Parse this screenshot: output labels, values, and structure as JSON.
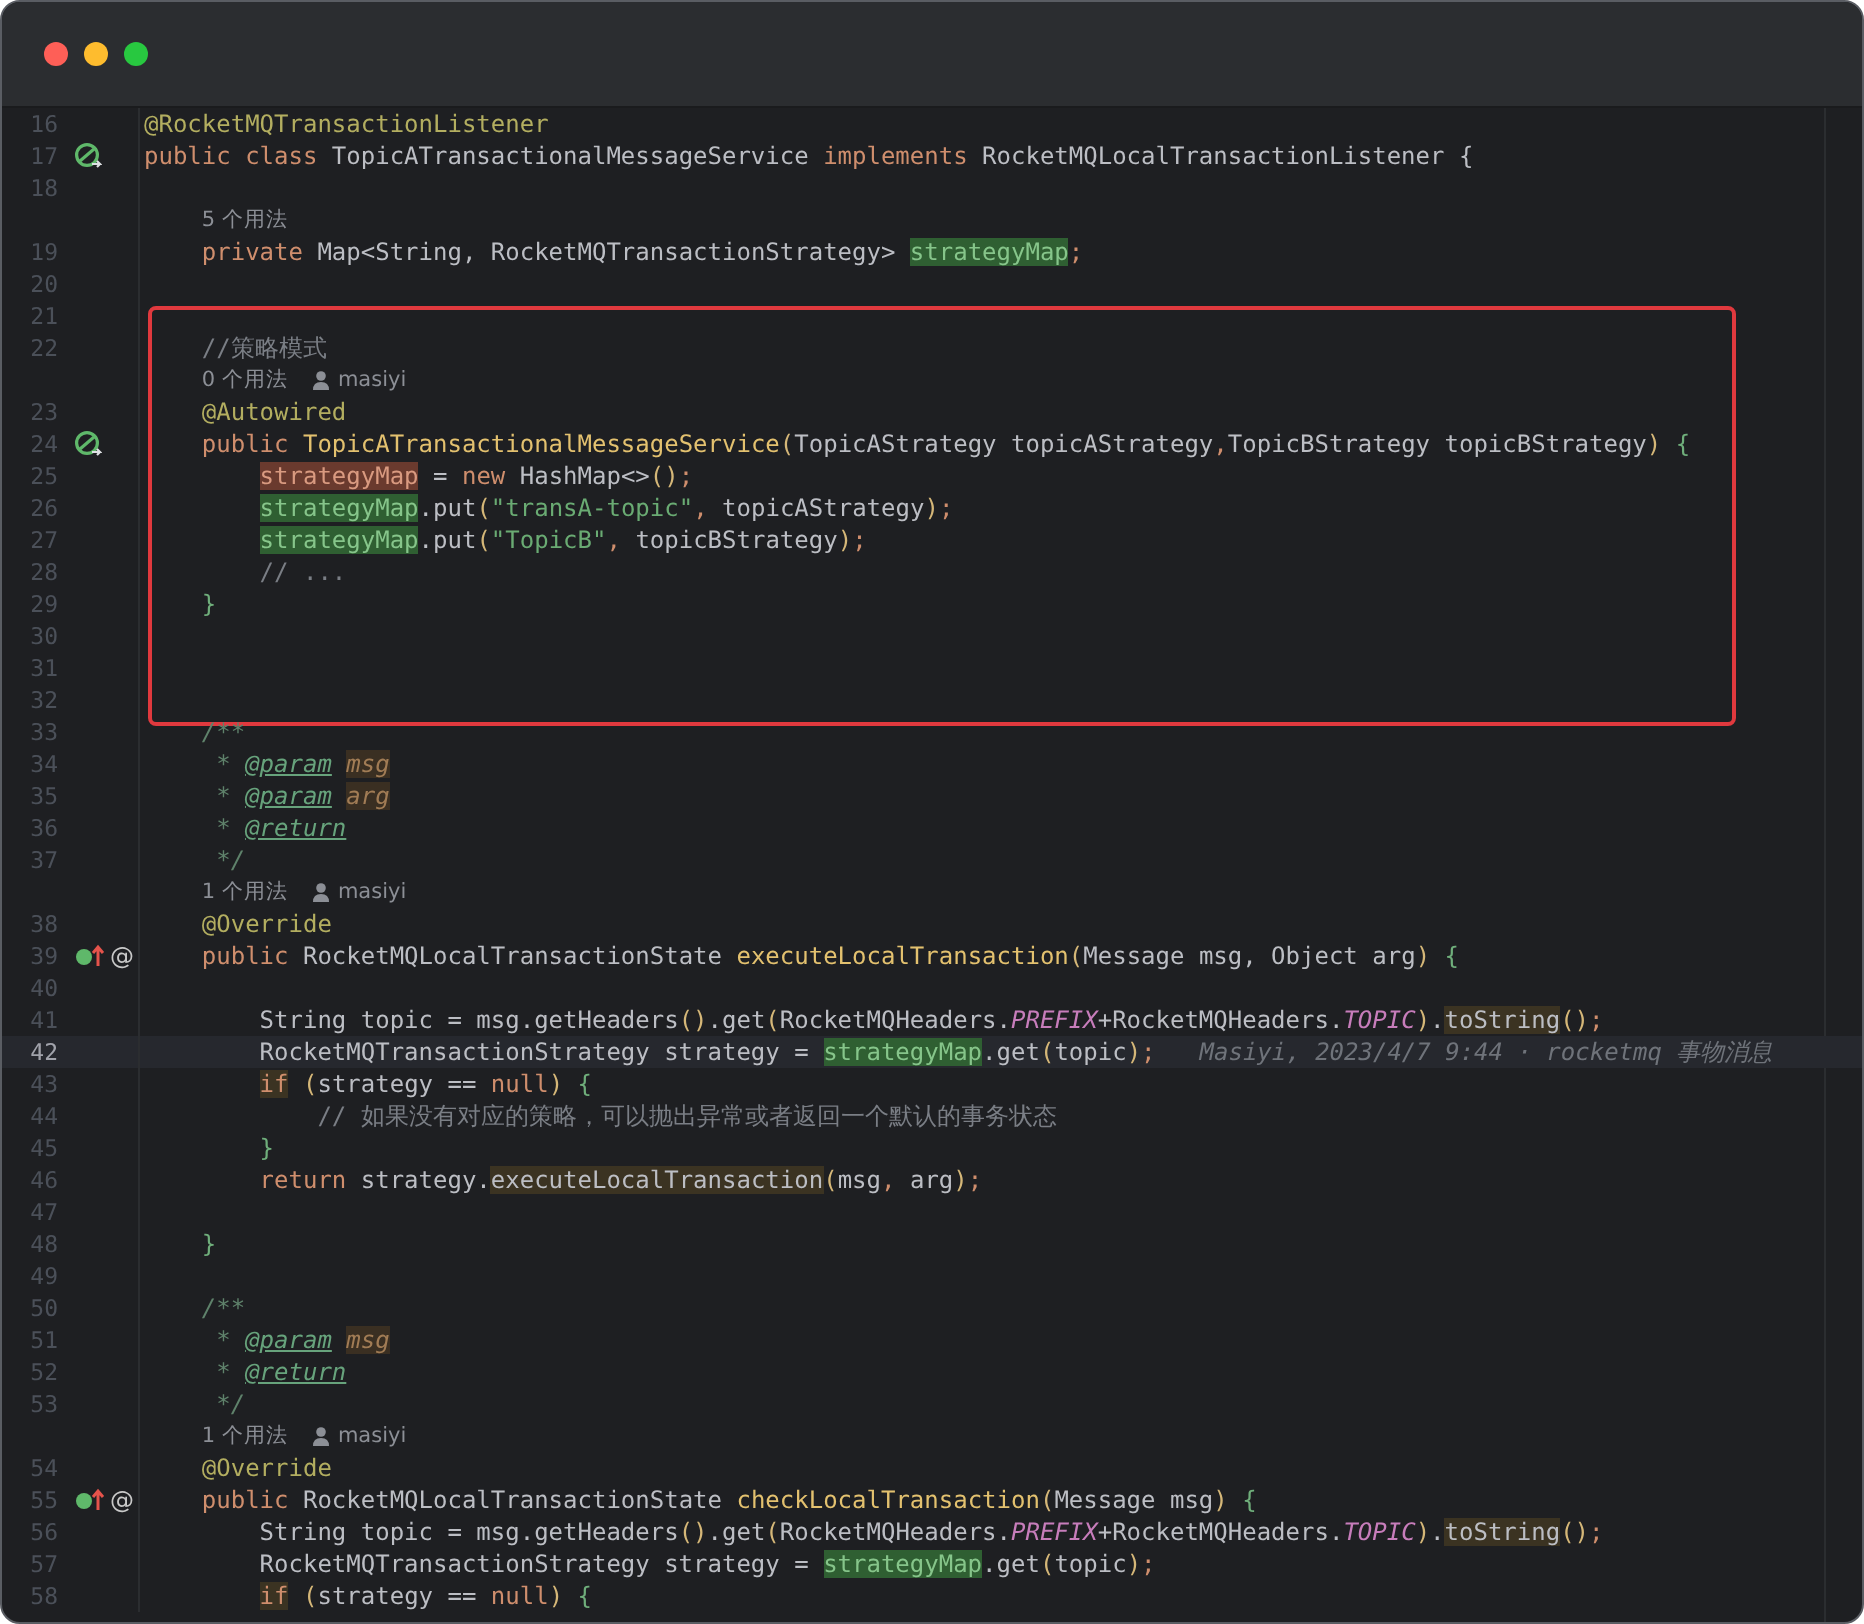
{
  "window": {
    "controls": [
      {
        "kind": "close"
      },
      {
        "kind": "minimize"
      },
      {
        "kind": "zoom"
      }
    ]
  },
  "editor": {
    "blocks": [
      {
        "framed": false,
        "rows": [
          {
            "kind": "line",
            "number": "16",
            "tokens": [
              {
                "kind": "annotation",
                "text": "@RocketMQTransactionListener"
              }
            ]
          },
          {
            "kind": "line",
            "number": "17",
            "gutter": {
              "kind": "bean"
            },
            "tokens": [
              {
                "kind": "keyword",
                "text": "public class "
              },
              {
                "kind": "plain",
                "text": "TopicATransactionalMessageService "
              },
              {
                "kind": "keyword",
                "text": "implements "
              },
              {
                "kind": "plain",
                "text": "RocketMQLocalTransactionListener {"
              }
            ]
          },
          {
            "kind": "line",
            "number": "18",
            "tokens": []
          },
          {
            "kind": "hint",
            "usages": "    5 个用法"
          },
          {
            "kind": "line",
            "number": "19",
            "tokens": [
              {
                "kind": "keyword",
                "text": "    private "
              },
              {
                "kind": "plain",
                "text": "Map<String, RocketMQTransactionStrategy> "
              },
              {
                "kind": "read-usage",
                "text": "strategyMap"
              },
              {
                "kind": "keyword",
                "text": ";"
              }
            ]
          },
          {
            "kind": "line",
            "number": "20",
            "tokens": []
          }
        ]
      },
      {
        "framed": true,
        "rows": [
          {
            "kind": "line",
            "number": "21",
            "tokens": []
          },
          {
            "kind": "line",
            "number": "22",
            "tokens": [
              {
                "kind": "comment",
                "text": "    //策略模式"
              }
            ]
          },
          {
            "kind": "hint",
            "usages": "    0 个用法",
            "author": "masiyi"
          },
          {
            "kind": "line",
            "number": "23",
            "tokens": [
              {
                "kind": "annotation",
                "text": "    @Autowired"
              }
            ]
          },
          {
            "kind": "line",
            "number": "24",
            "gutter": {
              "kind": "bean"
            },
            "tokens": [
              {
                "kind": "keyword",
                "text": "    public "
              },
              {
                "kind": "method",
                "text": "TopicATransactionalMessageService"
              },
              {
                "kind": "bracket",
                "text": "("
              },
              {
                "kind": "plain",
                "text": "TopicAStrategy topicAStrategy"
              },
              {
                "kind": "keyword",
                "text": ","
              },
              {
                "kind": "plain",
                "text": "TopicBStrategy topicBStrategy"
              },
              {
                "kind": "bracket",
                "text": ")"
              },
              {
                "kind": "brace",
                "text": " {"
              }
            ]
          },
          {
            "kind": "line",
            "number": "25",
            "tokens": [
              {
                "kind": "write-usage",
                "text": "        strategyMap"
              },
              {
                "kind": "plain",
                "text": " = "
              },
              {
                "kind": "keyword",
                "text": "new "
              },
              {
                "kind": "plain",
                "text": "HashMap<>"
              },
              {
                "kind": "bracket",
                "text": "()"
              },
              {
                "kind": "keyword",
                "text": ";"
              }
            ]
          },
          {
            "kind": "line",
            "number": "26",
            "tokens": [
              {
                "kind": "read-usage",
                "text": "        strategyMap"
              },
              {
                "kind": "plain",
                "text": ".put"
              },
              {
                "kind": "bracket",
                "text": "("
              },
              {
                "kind": "string",
                "text": "\"transA-topic\""
              },
              {
                "kind": "keyword",
                "text": ","
              },
              {
                "kind": "plain",
                "text": " topicAStrategy"
              },
              {
                "kind": "bracket",
                "text": ")"
              },
              {
                "kind": "keyword",
                "text": ";"
              }
            ]
          },
          {
            "kind": "line",
            "number": "27",
            "tokens": [
              {
                "kind": "read-usage",
                "text": "        strategyMap"
              },
              {
                "kind": "plain",
                "text": ".put"
              },
              {
                "kind": "bracket",
                "text": "("
              },
              {
                "kind": "string",
                "text": "\"TopicB\""
              },
              {
                "kind": "keyword",
                "text": ","
              },
              {
                "kind": "plain",
                "text": " topicBStrategy"
              },
              {
                "kind": "bracket",
                "text": ")"
              },
              {
                "kind": "keyword",
                "text": ";"
              }
            ]
          },
          {
            "kind": "line",
            "number": "28",
            "tokens": [
              {
                "kind": "comment",
                "text": "        // ..."
              }
            ]
          },
          {
            "kind": "line",
            "number": "29",
            "tokens": [
              {
                "kind": "brace",
                "text": "    }"
              }
            ]
          },
          {
            "kind": "line",
            "number": "30",
            "tokens": []
          },
          {
            "kind": "line",
            "number": "31",
            "tokens": []
          },
          {
            "kind": "line",
            "number": "32",
            "tokens": []
          }
        ]
      },
      {
        "framed": false,
        "rows": [
          {
            "kind": "line",
            "number": "33",
            "tokens": [
              {
                "kind": "doc",
                "text": "    /**"
              }
            ]
          },
          {
            "kind": "line",
            "number": "34",
            "tokens": [
              {
                "kind": "doc",
                "text": "     * "
              },
              {
                "kind": "doc-tag",
                "text": "@param"
              },
              {
                "kind": "doc-param",
                "text": " msg"
              }
            ]
          },
          {
            "kind": "line",
            "number": "35",
            "tokens": [
              {
                "kind": "doc",
                "text": "     * "
              },
              {
                "kind": "doc-tag",
                "text": "@param"
              },
              {
                "kind": "doc-param",
                "text": " arg"
              }
            ]
          },
          {
            "kind": "line",
            "number": "36",
            "tokens": [
              {
                "kind": "doc",
                "text": "     * "
              },
              {
                "kind": "doc-tag",
                "text": "@return"
              }
            ]
          },
          {
            "kind": "line",
            "number": "37",
            "tokens": [
              {
                "kind": "doc",
                "text": "     */"
              }
            ]
          },
          {
            "kind": "hint",
            "usages": "    1 个用法",
            "author": "masiyi"
          },
          {
            "kind": "line",
            "number": "38",
            "tokens": [
              {
                "kind": "annotation",
                "text": "    @Override"
              }
            ]
          },
          {
            "kind": "line",
            "number": "39",
            "gutter": {
              "kind": "implementing",
              "mark": "@"
            },
            "tokens": [
              {
                "kind": "keyword",
                "text": "    public "
              },
              {
                "kind": "plain",
                "text": "RocketMQLocalTransactionState "
              },
              {
                "kind": "method",
                "text": "executeLocalTransaction"
              },
              {
                "kind": "bracket",
                "text": "("
              },
              {
                "kind": "plain",
                "text": "Message msg, Object arg"
              },
              {
                "kind": "bracket",
                "text": ")"
              },
              {
                "kind": "brace",
                "text": " {"
              }
            ]
          },
          {
            "kind": "line",
            "number": "40",
            "tokens": []
          },
          {
            "kind": "line",
            "number": "41",
            "tokens": [
              {
                "kind": "plain",
                "text": "        String topic = msg.getHeaders"
              },
              {
                "kind": "bracket",
                "text": "()"
              },
              {
                "kind": "plain",
                "text": ".get"
              },
              {
                "kind": "bracket",
                "text": "("
              },
              {
                "kind": "plain",
                "text": "RocketMQHeaders."
              },
              {
                "kind": "constant",
                "text": "PREFIX"
              },
              {
                "kind": "plain",
                "text": "+RocketMQHeaders."
              },
              {
                "kind": "constant",
                "text": "TOPIC"
              },
              {
                "kind": "bracket",
                "text": ")"
              },
              {
                "kind": "plain",
                "text": "."
              },
              {
                "kind": "usage",
                "text": "toString"
              },
              {
                "kind": "bracket",
                "text": "()"
              },
              {
                "kind": "keyword",
                "text": ";"
              }
            ]
          },
          {
            "kind": "line",
            "number": "42",
            "current": true,
            "blame": "Masiyi, 2023/4/7 9:44 · rocketmq 事物消息",
            "tokens": [
              {
                "kind": "plain",
                "text": "        RocketMQTransactionStrategy strategy = "
              },
              {
                "kind": "read-usage",
                "text": "strategyMap"
              },
              {
                "kind": "plain",
                "text": ".get"
              },
              {
                "kind": "bracket",
                "text": "("
              },
              {
                "kind": "plain",
                "text": "topic"
              },
              {
                "kind": "bracket",
                "text": ")"
              },
              {
                "kind": "keyword",
                "text": ";"
              }
            ]
          },
          {
            "kind": "line",
            "number": "43",
            "tokens": [
              {
                "kind": "keyword-usage",
                "text": "        if"
              },
              {
                "kind": "bracket",
                "text": " ("
              },
              {
                "kind": "plain",
                "text": "strategy == "
              },
              {
                "kind": "keyword",
                "text": "null"
              },
              {
                "kind": "bracket",
                "text": ")"
              },
              {
                "kind": "brace",
                "text": " {"
              }
            ]
          },
          {
            "kind": "line",
            "number": "44",
            "tokens": [
              {
                "kind": "comment",
                "text": "            // 如果没有对应的策略，可以抛出异常或者返回一个默认的事务状态"
              }
            ]
          },
          {
            "kind": "line",
            "number": "45",
            "tokens": [
              {
                "kind": "brace",
                "text": "        }"
              }
            ]
          },
          {
            "kind": "line",
            "number": "46",
            "tokens": [
              {
                "kind": "keyword",
                "text": "        return "
              },
              {
                "kind": "plain",
                "text": "strategy."
              },
              {
                "kind": "usage",
                "text": "executeLocalTransaction"
              },
              {
                "kind": "bracket",
                "text": "("
              },
              {
                "kind": "plain",
                "text": "msg"
              },
              {
                "kind": "keyword",
                "text": ","
              },
              {
                "kind": "plain",
                "text": " arg"
              },
              {
                "kind": "bracket",
                "text": ")"
              },
              {
                "kind": "keyword",
                "text": ";"
              }
            ]
          },
          {
            "kind": "line",
            "number": "47",
            "tokens": []
          },
          {
            "kind": "line",
            "number": "48",
            "tokens": [
              {
                "kind": "brace",
                "text": "    }"
              }
            ]
          },
          {
            "kind": "line",
            "number": "49",
            "tokens": []
          },
          {
            "kind": "line",
            "number": "50",
            "tokens": [
              {
                "kind": "doc",
                "text": "    /**"
              }
            ]
          },
          {
            "kind": "line",
            "number": "51",
            "tokens": [
              {
                "kind": "doc",
                "text": "     * "
              },
              {
                "kind": "doc-tag",
                "text": "@param"
              },
              {
                "kind": "doc-param",
                "text": " msg"
              }
            ]
          },
          {
            "kind": "line",
            "number": "52",
            "tokens": [
              {
                "kind": "doc",
                "text": "     * "
              },
              {
                "kind": "doc-tag",
                "text": "@return"
              }
            ]
          },
          {
            "kind": "line",
            "number": "53",
            "tokens": [
              {
                "kind": "doc",
                "text": "     */"
              }
            ]
          },
          {
            "kind": "hint",
            "usages": "    1 个用法",
            "author": "masiyi"
          },
          {
            "kind": "line",
            "number": "54",
            "tokens": [
              {
                "kind": "annotation",
                "text": "    @Override"
              }
            ]
          },
          {
            "kind": "line",
            "number": "55",
            "gutter": {
              "kind": "implementing",
              "mark": "@"
            },
            "tokens": [
              {
                "kind": "keyword",
                "text": "    public "
              },
              {
                "kind": "plain",
                "text": "RocketMQLocalTransactionState "
              },
              {
                "kind": "method",
                "text": "checkLocalTransaction"
              },
              {
                "kind": "bracket",
                "text": "("
              },
              {
                "kind": "plain",
                "text": "Message msg"
              },
              {
                "kind": "bracket",
                "text": ")"
              },
              {
                "kind": "brace",
                "text": " {"
              }
            ]
          },
          {
            "kind": "line",
            "number": "56",
            "tokens": [
              {
                "kind": "plain",
                "text": "        String topic = msg.getHeaders"
              },
              {
                "kind": "bracket",
                "text": "()"
              },
              {
                "kind": "plain",
                "text": ".get"
              },
              {
                "kind": "bracket",
                "text": "("
              },
              {
                "kind": "plain",
                "text": "RocketMQHeaders."
              },
              {
                "kind": "constant",
                "text": "PREFIX"
              },
              {
                "kind": "plain",
                "text": "+RocketMQHeaders."
              },
              {
                "kind": "constant",
                "text": "TOPIC"
              },
              {
                "kind": "bracket",
                "text": ")"
              },
              {
                "kind": "plain",
                "text": "."
              },
              {
                "kind": "usage",
                "text": "toString"
              },
              {
                "kind": "bracket",
                "text": "()"
              },
              {
                "kind": "keyword",
                "text": ";"
              }
            ]
          },
          {
            "kind": "line",
            "number": "57",
            "tokens": [
              {
                "kind": "plain",
                "text": "        RocketMQTransactionStrategy strategy = "
              },
              {
                "kind": "read-usage",
                "text": "strategyMap"
              },
              {
                "kind": "plain",
                "text": ".get"
              },
              {
                "kind": "bracket",
                "text": "("
              },
              {
                "kind": "plain",
                "text": "topic"
              },
              {
                "kind": "bracket",
                "text": ")"
              },
              {
                "kind": "keyword",
                "text": ";"
              }
            ]
          },
          {
            "kind": "line",
            "number": "58",
            "tokens": [
              {
                "kind": "keyword-usage",
                "text": "        if"
              },
              {
                "kind": "bracket",
                "text": " ("
              },
              {
                "kind": "plain",
                "text": "strategy == "
              },
              {
                "kind": "keyword",
                "text": "null"
              },
              {
                "kind": "bracket",
                "text": ")"
              },
              {
                "kind": "brace",
                "text": " {"
              }
            ]
          }
        ]
      }
    ]
  }
}
